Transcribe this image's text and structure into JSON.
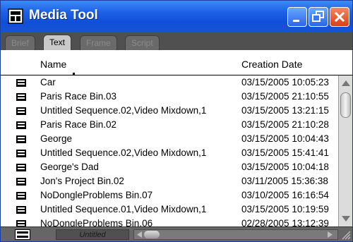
{
  "window": {
    "title": "Media Tool",
    "icon": "media-tool-icon",
    "controls": [
      "minimize-icon",
      "restore-icon",
      "close-icon"
    ]
  },
  "tabs": [
    {
      "label": "Brief",
      "active": false
    },
    {
      "label": "Text",
      "active": true
    },
    {
      "label": "Frame",
      "active": false
    },
    {
      "label": "Script",
      "active": false
    }
  ],
  "columns": {
    "name": "Name",
    "creation_date": "Creation Date"
  },
  "rows": [
    {
      "name": "Car",
      "date": "03/15/2005 10:05:23"
    },
    {
      "name": "Paris Race Bin.03",
      "date": "03/15/2005 21:10:55"
    },
    {
      "name": "Untitled Sequence.02,Video Mixdown,1",
      "date": "03/15/2005 13:21:15"
    },
    {
      "name": "Paris Race Bin.02",
      "date": "03/15/2005 21:10:28"
    },
    {
      "name": "George",
      "date": "03/15/2005 10:04:43"
    },
    {
      "name": "Untitled Sequence.02,Video Mixdown,1",
      "date": "03/15/2005 15:41:41"
    },
    {
      "name": "George's Dad",
      "date": "03/15/2005 10:04:18"
    },
    {
      "name": "Jon's Project Bin.02",
      "date": "03/11/2005 15:36:38"
    },
    {
      "name": "NoDongleProblems Bin.07",
      "date": "03/10/2005 16:16:54"
    },
    {
      "name": "Untitled Sequence.01,Video Mixdown,1",
      "date": "03/15/2005 10:19:59"
    },
    {
      "name": "NoDongleProblems Bin.06",
      "date": "02/28/2005 13:12:39"
    }
  ],
  "footer": {
    "view_name": "Untitled"
  },
  "colors": {
    "titlebar": "#1f62e6",
    "close_button": "#d8401a",
    "panel": "#6b6b6b"
  }
}
